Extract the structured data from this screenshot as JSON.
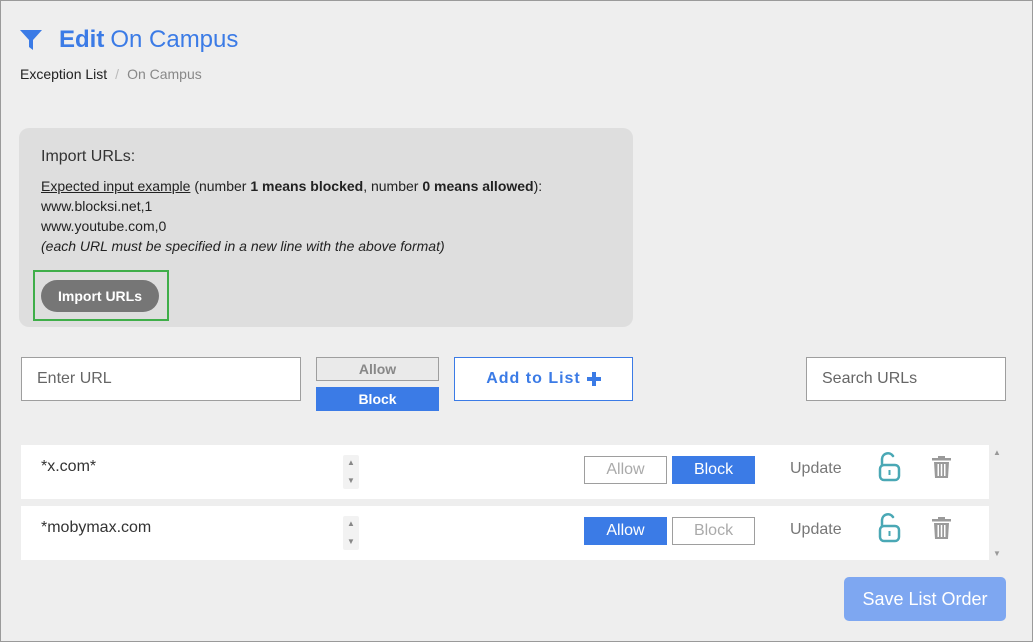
{
  "header": {
    "icon": "filter-icon",
    "title_bold": "Edit",
    "title_rest": "On Campus",
    "accent_color": "#3b7be6"
  },
  "breadcrumb": {
    "home": "Exception List",
    "separator": "/",
    "current": "On Campus"
  },
  "import_panel": {
    "title": "Import URLs:",
    "example_link": "Expected input example",
    "desc_part1": " (number ",
    "desc_bold1": "1 means blocked",
    "desc_part2": ", number ",
    "desc_bold2": "0 means allowed",
    "desc_part3": "):",
    "example_line1": "www.blocksi.net,1",
    "example_line2": "www.youtube.com,0",
    "note": "(each URL must be specified in a new line with the above format)",
    "button_label": "Import URLs"
  },
  "entry": {
    "url_placeholder": "Enter URL",
    "allow_label": "Allow",
    "block_label": "Block",
    "selected": "Block",
    "add_label": "Add to List",
    "add_icon": "plus-icon",
    "search_placeholder": "Search URLs"
  },
  "list": {
    "rows": [
      {
        "url": "*x.com*",
        "allow_label": "Allow",
        "block_label": "Block",
        "selected": "Block",
        "update_label": "Update"
      },
      {
        "url": "*mobymax.com",
        "allow_label": "Allow",
        "block_label": "Block",
        "selected": "Allow",
        "update_label": "Update"
      }
    ]
  },
  "spinner": {
    "up": "▲",
    "down": "▼"
  },
  "save_button": "Save List Order"
}
